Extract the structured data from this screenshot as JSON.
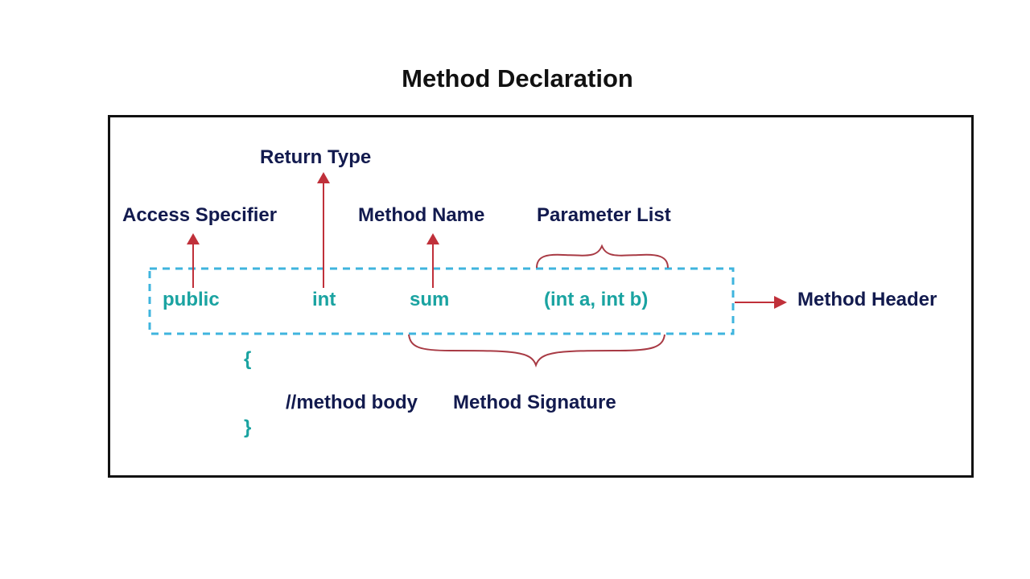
{
  "title": "Method Declaration",
  "labels": {
    "return_type": "Return Type",
    "access_specifier": "Access Specifier",
    "method_name": "Method Name",
    "parameter_list": "Parameter List",
    "method_header": "Method Header",
    "method_signature": "Method Signature"
  },
  "code": {
    "access_modifier": "public",
    "return_type": "int",
    "method_name": "sum",
    "parameters": "(int a, int b)",
    "open_brace": "{",
    "body_comment": "//method body",
    "close_brace": "}"
  },
  "colors": {
    "label": "#121a4e",
    "code": "#1aa3a1",
    "arrow": "#c0303a",
    "dashed_box": "#3fb4de",
    "frame": "#111111"
  }
}
